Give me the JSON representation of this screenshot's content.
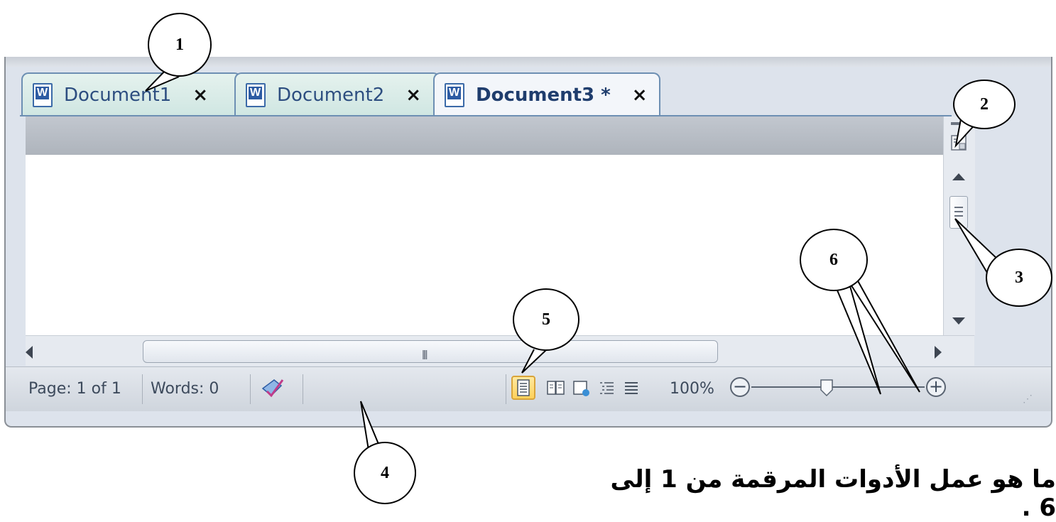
{
  "tabs": [
    {
      "label": "Document1",
      "close": "×"
    },
    {
      "label": "Document2",
      "close": "×"
    },
    {
      "label": "Document3 *",
      "close": "×"
    }
  ],
  "statusbar": {
    "page": "Page: 1 of 1",
    "words": "Words: 0",
    "zoom": "100%"
  },
  "zoom_level_percent": 100,
  "callouts": [
    "1",
    "2",
    "3",
    "4",
    "5",
    "6"
  ],
  "question": "ما هو عمل الأدوات المرقمة من 1 إلى 6 .",
  "icons": [
    "word-doc-icon",
    "close-icon",
    "view-ruler-icon",
    "scroll-up-icon",
    "scroll-down-icon",
    "scroll-left-icon",
    "scroll-right-icon",
    "proofing-icon",
    "print-layout-icon",
    "full-screen-reading-icon",
    "web-layout-icon",
    "outline-icon",
    "draft-icon",
    "zoom-out-icon",
    "zoom-in-icon",
    "resize-grip-icon"
  ],
  "colors": {
    "tab_border": "#6d8fb3",
    "active_view": "#ffd15a"
  }
}
